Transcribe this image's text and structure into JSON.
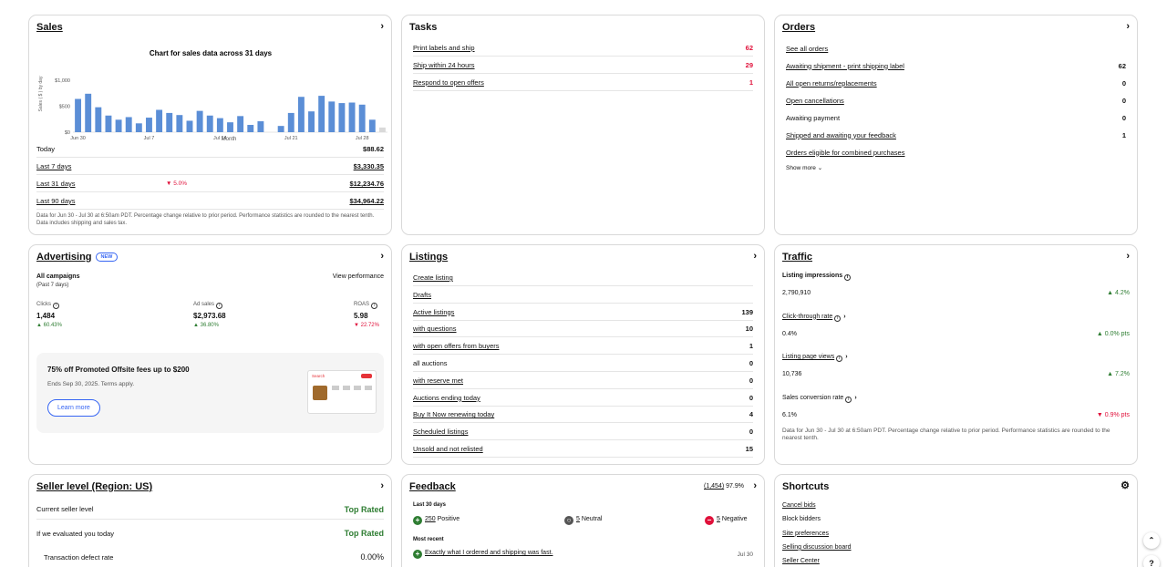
{
  "sales": {
    "title": "Sales",
    "chart_title": "Chart for sales data across 31 days",
    "chart_data": {
      "type": "bar",
      "title": "Chart for sales data across 31 days",
      "xlabel": "Month",
      "ylabel": "Sales ( $ ) by day",
      "y_ticks": [
        "$1,000",
        "$500",
        "$0"
      ],
      "x_ticks": [
        "Jun 30",
        "Jul 7",
        "Jul 14",
        "Jul 21",
        "Jul 28"
      ],
      "ylim": [
        0,
        1000
      ],
      "values": [
        640,
        740,
        480,
        320,
        240,
        290,
        170,
        280,
        430,
        370,
        330,
        220,
        410,
        320,
        270,
        190,
        310,
        140,
        210,
        0,
        120,
        370,
        680,
        400,
        700,
        590,
        560,
        570,
        530,
        240,
        90
      ],
      "color": "#5b8ed6",
      "last_color": "#d9d9d9"
    },
    "rows": [
      {
        "label": "Today",
        "value": "$88.62",
        "link": false
      },
      {
        "label": "Last 7 days",
        "value": "$3,330.35",
        "link": true
      },
      {
        "label": "Last 31 days",
        "value": "$12,234.76",
        "link": true,
        "change": "5.0%"
      },
      {
        "label": "Last 90 days",
        "value": "$34,964.22",
        "link": true
      }
    ],
    "note": "Data for Jun 30 - Jul 30 at 6:50am PDT. Percentage change relative to prior period. Performance statistics are rounded to the nearest tenth. Data includes shipping and sales tax."
  },
  "tasks": {
    "title": "Tasks",
    "rows": [
      {
        "label": "Print labels and ship",
        "value": "62"
      },
      {
        "label": "Ship within 24 hours",
        "value": "29"
      },
      {
        "label": "Respond to open offers",
        "value": "1"
      }
    ]
  },
  "orders": {
    "title": "Orders",
    "rows": [
      {
        "label": "See all orders",
        "value": ""
      },
      {
        "label": "Awaiting shipment - print shipping label",
        "value": "62"
      },
      {
        "label": "All open returns/replacements",
        "value": "0"
      },
      {
        "label": "Open cancellations",
        "value": "0"
      },
      {
        "label": "Awaiting payment",
        "value": "0"
      },
      {
        "label": "Shipped and awaiting your feedback",
        "value": "1"
      },
      {
        "label": "Orders eligible for combined purchases",
        "value": ""
      }
    ],
    "show_more": "Show more"
  },
  "advertising": {
    "title": "Advertising",
    "badge": "NEW",
    "campaigns": "All campaigns",
    "period": "(Past 7 days)",
    "view": "View performance",
    "metrics": [
      {
        "label": "Clicks",
        "value": "1,484",
        "change": "60.43%",
        "dir": "up"
      },
      {
        "label": "Ad sales",
        "value": "$2,973.68",
        "change": "36.80%",
        "dir": "up"
      },
      {
        "label": "ROAS",
        "value": "5.98",
        "change": "22.72%",
        "dir": "down"
      }
    ],
    "promo_title": "75% off Promoted Offsite fees up to $200",
    "promo_sub": "Ends Sep 30, 2025. Terms apply.",
    "promo_btn": "Learn more",
    "promo_search": "Search"
  },
  "listings": {
    "title": "Listings",
    "rows": [
      {
        "label": "Create listing",
        "value": ""
      },
      {
        "label": "Drafts",
        "value": ""
      },
      {
        "label": "Active listings",
        "value": "139"
      },
      {
        "label": "with questions",
        "value": "10"
      },
      {
        "label": "with open offers from buyers",
        "value": "1"
      },
      {
        "label": "all auctions",
        "value": "0"
      },
      {
        "label": "with reserve met",
        "value": "0"
      },
      {
        "label": "Auctions ending today",
        "value": "0"
      },
      {
        "label": "Buy It Now renewing today",
        "value": "4"
      },
      {
        "label": "Scheduled listings",
        "value": "0"
      },
      {
        "label": "Unsold and not relisted",
        "value": "15"
      }
    ]
  },
  "traffic": {
    "title": "Traffic",
    "items": [
      {
        "label": "Listing impressions",
        "value": "2,790,910",
        "change": "4.2%",
        "dir": "up"
      },
      {
        "label": "Click-through rate",
        "value": "0.4%",
        "change": "0.0% pts",
        "dir": "up"
      },
      {
        "label": "Listing page views",
        "value": "10,736",
        "change": "7.2%",
        "dir": "up"
      },
      {
        "label": "Sales conversion rate",
        "value": "6.1%",
        "change": "0.9% pts",
        "dir": "down"
      }
    ],
    "note": "Data for Jun 30 - Jul 30 at 6:50am PDT. Percentage change relative to prior period. Performance statistics are rounded to the nearest tenth."
  },
  "seller": {
    "title": "Seller level (Region: US)",
    "rows": [
      {
        "label": "Current seller level",
        "value": "Top Rated"
      },
      {
        "label": "If we evaluated you today",
        "value": "Top Rated"
      },
      {
        "label": "Transaction defect rate",
        "value": "0.00%"
      }
    ]
  },
  "feedback": {
    "title": "Feedback",
    "summary_count": "(1,454)",
    "summary_pct": "97.9%",
    "period": "Last 30 days",
    "positive_count": "250",
    "positive": "Positive",
    "neutral_count": "5",
    "neutral": "Neutral",
    "negative_count": "5",
    "negative": "Negative",
    "most_recent": "Most recent",
    "recent_text": "Exactly what I ordered and shipping was fast.",
    "recent_date": "Jul 30"
  },
  "shortcuts": {
    "title": "Shortcuts",
    "items": [
      "Cancel bids",
      "Block bidders",
      "Site preferences",
      "Selling discussion board",
      "Seller Center"
    ]
  }
}
